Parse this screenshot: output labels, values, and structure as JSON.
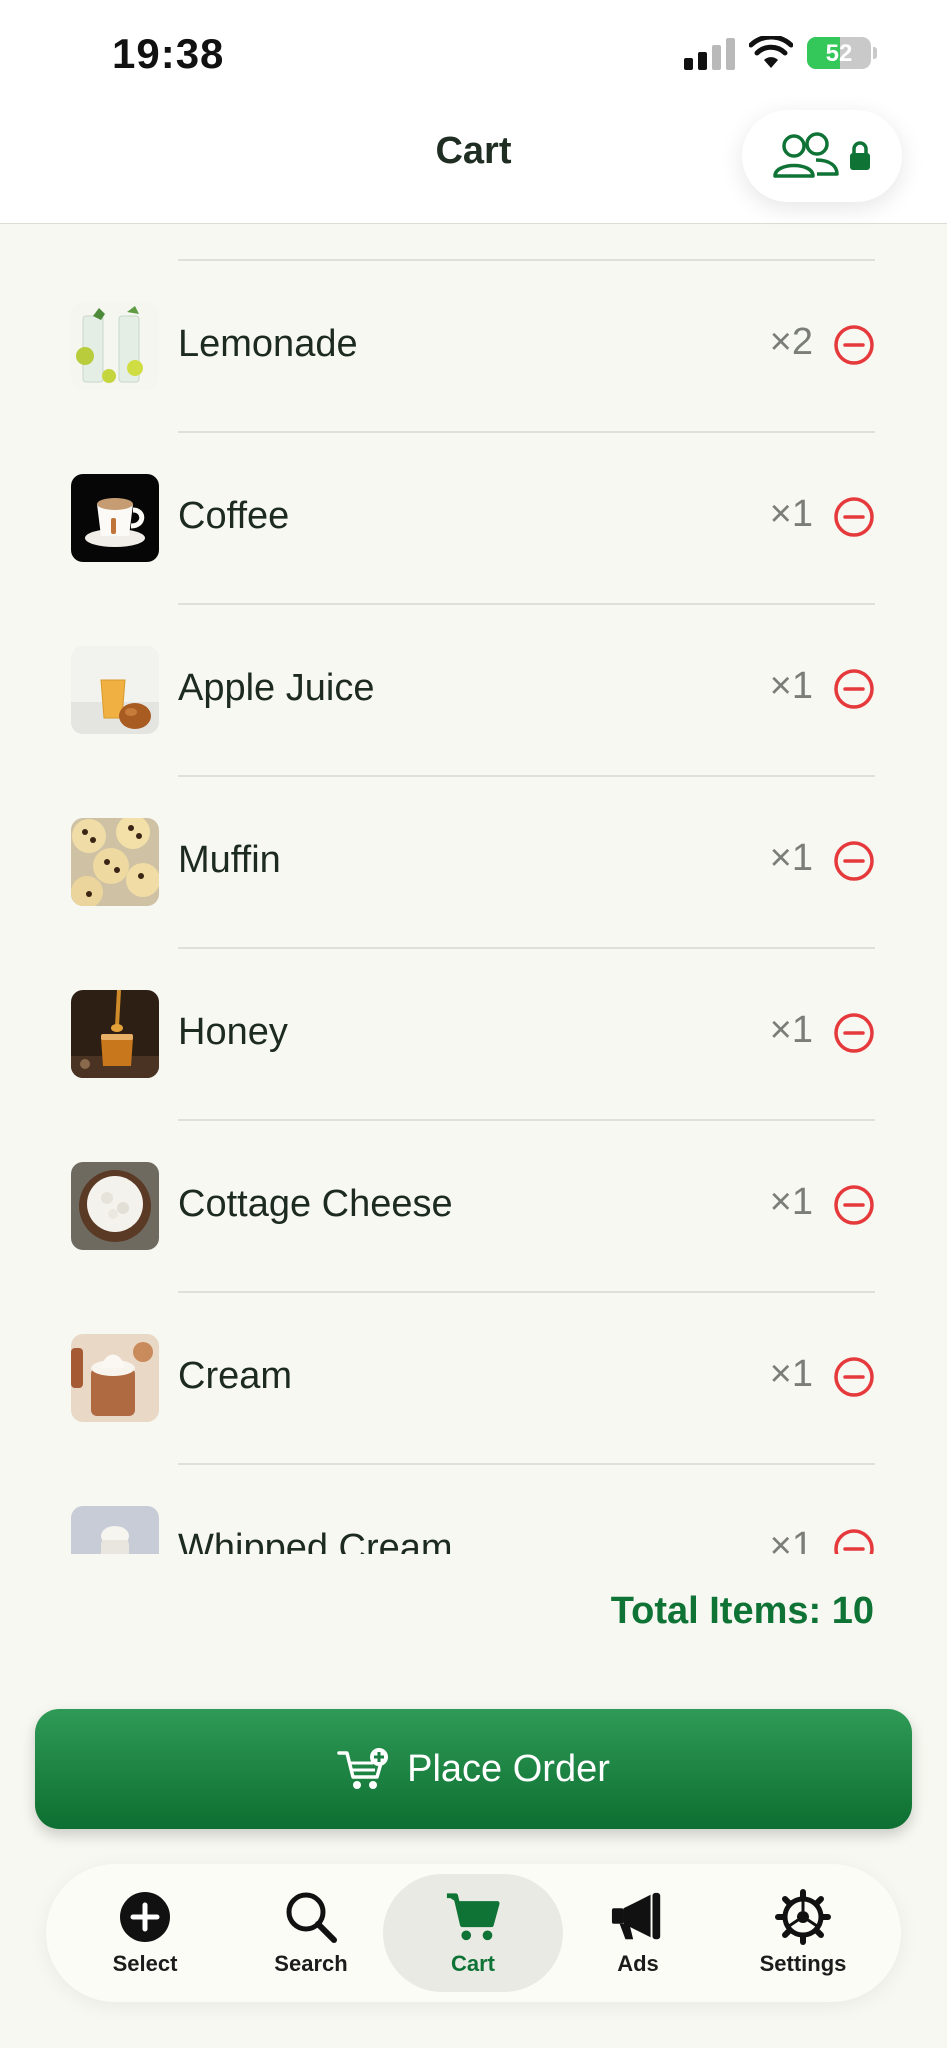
{
  "status": {
    "time": "19:38",
    "battery": "52",
    "battery_level": 0.52
  },
  "header": {
    "title": "Cart"
  },
  "items": [
    {
      "name": "Lemonade",
      "qty": "×2"
    },
    {
      "name": "Coffee",
      "qty": "×1"
    },
    {
      "name": "Apple Juice",
      "qty": "×1"
    },
    {
      "name": "Muffin",
      "qty": "×1"
    },
    {
      "name": "Honey",
      "qty": "×1"
    },
    {
      "name": "Cottage Cheese",
      "qty": "×1"
    },
    {
      "name": "Cream",
      "qty": "×1"
    },
    {
      "name": "Whipped Cream",
      "qty": "×1"
    }
  ],
  "total_label": "Total Items: 10",
  "place_order_label": "Place Order",
  "tabs": [
    {
      "label": "Select",
      "icon": "plus-circle-icon"
    },
    {
      "label": "Search",
      "icon": "magnifier-icon"
    },
    {
      "label": "Cart",
      "icon": "cart-icon",
      "active": true
    },
    {
      "label": "Ads",
      "icon": "megaphone-icon"
    },
    {
      "label": "Settings",
      "icon": "gear-icon"
    }
  ],
  "colors": {
    "accent": "#0f7336",
    "remove": "#e5393c",
    "background": "#f7f8f1"
  }
}
